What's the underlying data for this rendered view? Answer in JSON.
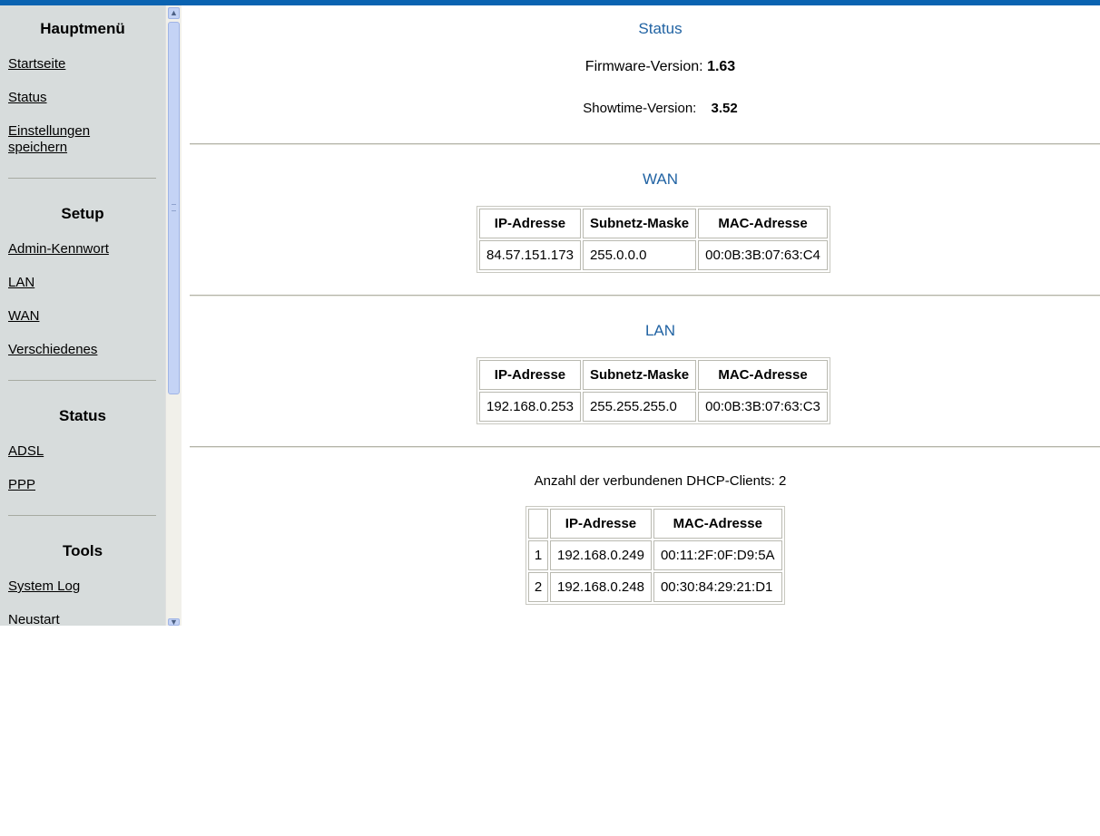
{
  "sidebar": {
    "sections": [
      {
        "title": "Hauptmenü",
        "links": [
          "Startseite",
          "Status",
          "Einstellungen speichern"
        ]
      },
      {
        "title": "Setup",
        "links": [
          "Admin-Kennwort",
          "LAN",
          "WAN",
          "Verschiedenes"
        ]
      },
      {
        "title": "Status",
        "links": [
          "ADSL",
          "PPP"
        ]
      },
      {
        "title": "Tools",
        "links": [
          "System Log",
          "Neustart"
        ]
      }
    ]
  },
  "main": {
    "status_title": "Status",
    "firmware_label": "Firmware-Version:",
    "firmware_value": "1.63",
    "showtime_label": "Showtime-Version:",
    "showtime_value": "3.52",
    "wan": {
      "title": "WAN",
      "headers": [
        "IP-Adresse",
        "Subnetz-Maske",
        "MAC-Adresse"
      ],
      "row": [
        "84.57.151.173",
        "255.0.0.0",
        "00:0B:3B:07:63:C4"
      ]
    },
    "lan": {
      "title": "LAN",
      "headers": [
        "IP-Adresse",
        "Subnetz-Maske",
        "MAC-Adresse"
      ],
      "row": [
        "192.168.0.253",
        "255.255.255.0",
        "00:0B:3B:07:63:C3"
      ]
    },
    "dhcp": {
      "count_text": "Anzahl der verbundenen DHCP-Clients: 2",
      "headers": [
        "",
        "IP-Adresse",
        "MAC-Adresse"
      ],
      "rows": [
        [
          "1",
          "192.168.0.249",
          "00:11:2F:0F:D9:5A"
        ],
        [
          "2",
          "192.168.0.248",
          "00:30:84:29:21:D1"
        ]
      ]
    }
  },
  "colors": {
    "accent": "#0a63b1",
    "heading": "#2163a3",
    "sidebar_bg": "#d7dcdc"
  },
  "icons": {
    "scroll_up": "chevron-up-icon",
    "scroll_down": "chevron-down-icon"
  }
}
